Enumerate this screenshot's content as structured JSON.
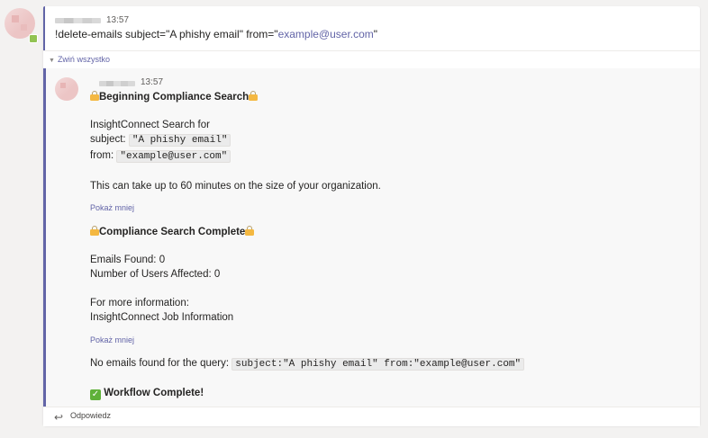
{
  "message": {
    "time": "13:57",
    "command_prefix": "!delete-emails subject=\"A phishy email\" from=\"",
    "command_link": "example@user.com",
    "command_suffix": "\""
  },
  "thread": {
    "collapse_label": "Zwiń wszystko"
  },
  "reply": {
    "time": "13:57",
    "heading1": "Beginning Compliance Search",
    "search_for": "InsightConnect Search for",
    "subject_label": "subject:",
    "subject_value": "\"A phishy email\"",
    "from_label": "from:",
    "from_value": "\"example@user.com\"",
    "duration_note": "This can take up to 60 minutes on the size of your organization.",
    "show_less_1": "Pokaż mniej",
    "heading2": "Compliance Search Complete",
    "emails_found": "Emails Found: 0",
    "users_affected": "Number of Users Affected: 0",
    "more_info": "For more information:",
    "job_link": "InsightConnect Job Information",
    "show_less_2": "Pokaż mniej",
    "no_emails_label": "No emails found for the query:",
    "query_value": "subject:\"A phishy email\" from:\"example@user.com\"",
    "workflow_complete": "Workflow Complete!"
  },
  "footer": {
    "reply_label": "Odpowiedz"
  },
  "colors": {
    "accent": "#6264a7",
    "presence": "#92c353",
    "lock": "#f4b841",
    "check": "#5fb139"
  },
  "icons": {
    "lock": "lock-icon",
    "check": "check-mark-icon",
    "reply": "reply-arrow-icon",
    "collapse": "chevron-down-icon"
  }
}
